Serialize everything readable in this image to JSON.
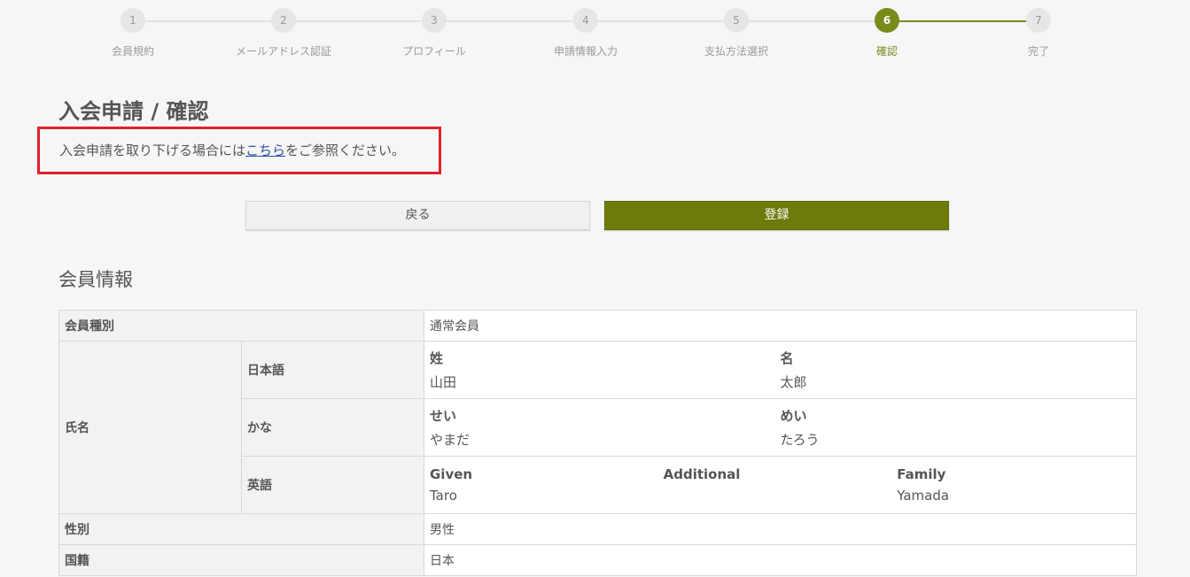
{
  "stepper": {
    "steps": [
      {
        "num": "1",
        "label": "会員規約"
      },
      {
        "num": "2",
        "label": "メールアドレス認証"
      },
      {
        "num": "3",
        "label": "プロフィール"
      },
      {
        "num": "4",
        "label": "申請情報入力"
      },
      {
        "num": "5",
        "label": "支払方法選択"
      },
      {
        "num": "6",
        "label": "確認"
      },
      {
        "num": "7",
        "label": "完了"
      }
    ],
    "current": 6,
    "accent_color": "#7a8a1a"
  },
  "page": {
    "title": "入会申請 / 確認",
    "notice_before": "入会申請を取り下げる場合には",
    "notice_link": "こちら",
    "notice_after": "をご参照ください。"
  },
  "buttons": {
    "back": "戻る",
    "submit": "登録",
    "submit_color": "#6e7a0a"
  },
  "section": {
    "title": "会員情報"
  },
  "table": {
    "member_type": {
      "label": "会員種別",
      "value": "通常会員"
    },
    "name": {
      "label": "氏名",
      "japanese": {
        "label": "日本語",
        "last_label": "姓",
        "last": "山田",
        "first_label": "名",
        "first": "太郎"
      },
      "kana": {
        "label": "かな",
        "last_label": "せい",
        "last": "やまだ",
        "first_label": "めい",
        "first": "たろう"
      },
      "english": {
        "label": "英語",
        "given_label": "Given",
        "given": "Taro",
        "additional_label": "Additional",
        "additional": "",
        "family_label": "Family",
        "family": "Yamada"
      }
    },
    "gender": {
      "label": "性別",
      "value": "男性"
    },
    "nationality": {
      "label": "国籍",
      "value": "日本"
    }
  }
}
